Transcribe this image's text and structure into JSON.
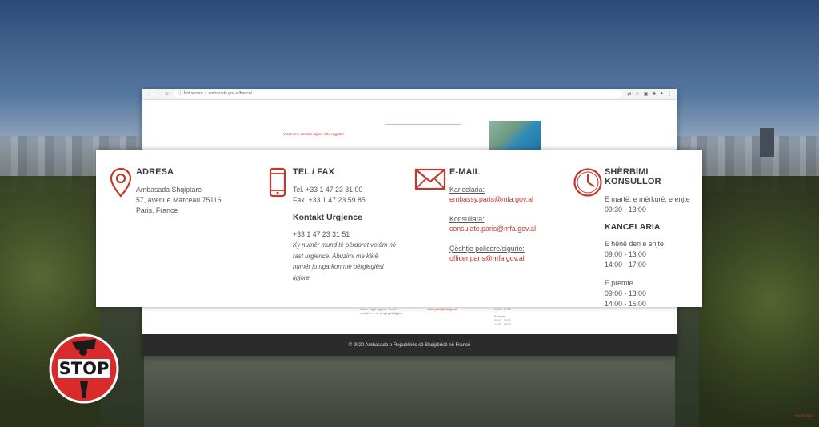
{
  "browser": {
    "url_prefix": "Not secure",
    "url": "ambasada.gov.al/france/",
    "page_note": "Vetëm me dëmtim fajtore dhe regjistër",
    "mini_col1": "Vetëm rrugët urgjente. Numër mundësh ... me përgjegjësi ligjore",
    "mini_col2": "officer.paris@mfa.gov.al",
    "mini_col3_a": "14:00 - 17:00",
    "mini_col3_b": "E premte",
    "mini_col3_c": "09:00 - 13:00",
    "mini_col3_d": "14:00 - 15:00",
    "footer": "© 2020 Ambasada e Republikës së Shqipërisë në Francë"
  },
  "contact": {
    "address": {
      "title": "ADRESA",
      "line1": "Ambasada Shqiptare",
      "line2": "57, avenue Marceau 75116",
      "line3": "Paris, France"
    },
    "phone": {
      "title": "TEL / FAX",
      "tel": "Tel. +33 1 47 23 31 00",
      "fax": "Fax. +33 1 47 23 59 85",
      "emergency_title": "Kontakt Urgjence",
      "emergency_number": "+33 1 47 23 31 51",
      "emergency_note": "Ky numër mund të përdoret vetëm në rast urgjence. Abuzimi me këtë numër ju ngarkon me përgjegjësi ligjore"
    },
    "email": {
      "title": "E-MAIL",
      "label1": "Kancelaria:",
      "mail1": "embassy.paris@mfa.gov.al",
      "label2": "Konsullata:",
      "mail2": "consulate.paris@mfa.gov.al",
      "label3": "Çështje policore/sigurie:",
      "mail3": "officer.paris@mfa.gov.al"
    },
    "consular": {
      "title": "SHËRBIMI KONSULLOR",
      "days": "E martë, e mërkurë, e enjte",
      "hours": "09:30 - 13:00",
      "chancery_title": "KANCELARIA",
      "chancery_days": "E hënë deri e enjte",
      "chancery_h1": "09:00 - 13:00",
      "chancery_h2": "14:00 - 17:00",
      "friday": "E premte",
      "friday_h1": "09:00 - 13:00",
      "friday_h2": "14:00 - 15:00"
    }
  },
  "logo": {
    "text": "STOP"
  },
  "watermark": "Exclusiv",
  "colors": {
    "accent_red": "#c0392b",
    "footer_bg": "#2b2b2b",
    "text_gray": "#555555"
  },
  "icons": [
    "location-pin-icon",
    "mobile-phone-icon",
    "envelope-icon",
    "clock-icon"
  ]
}
